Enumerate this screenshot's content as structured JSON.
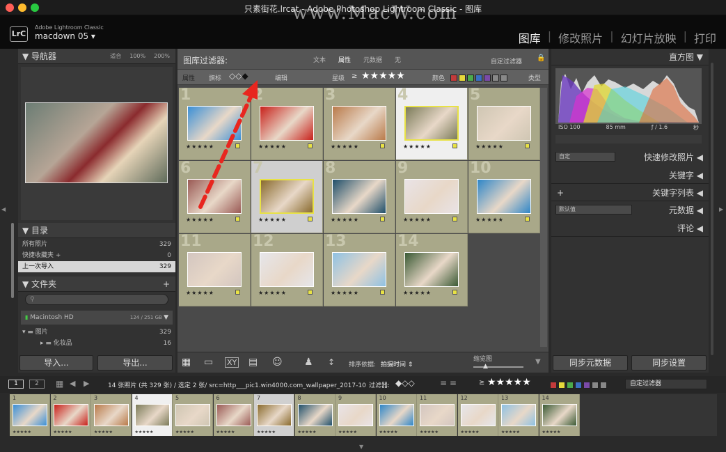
{
  "window": {
    "title": "只素街花.lrcat - Adobe Photoshop Lightroom Classic - 图库"
  },
  "watermark": "www.MacW.com",
  "identity": {
    "app": "Adobe Lightroom Classic",
    "catalog": "macdown 05"
  },
  "modules": [
    "图库",
    "修改照片",
    "幻灯片放映",
    "打印"
  ],
  "navigator": {
    "title": "导航器",
    "zoom": [
      "适合",
      "100%",
      "200%"
    ]
  },
  "catalog_panel": {
    "title": "目录",
    "items": [
      {
        "label": "所有照片",
        "count": "329"
      },
      {
        "label": "快捷收藏夹 +",
        "count": "0"
      },
      {
        "label": "上一次导入",
        "count": "329"
      }
    ]
  },
  "folders": {
    "title": "文件夹",
    "search_placeholder": "",
    "volume": "Macintosh HD",
    "volume_size": "124 / 251 GB",
    "items": [
      {
        "label": "图片",
        "count": "329"
      },
      {
        "label": "化妆品",
        "count": "16"
      }
    ]
  },
  "left_buttons": {
    "import": "导入...",
    "export": "导出..."
  },
  "filter": {
    "title": "图库过滤器:",
    "tabs": [
      "文本",
      "属性",
      "元数据",
      "无"
    ],
    "preset": "自定过滤器",
    "attr_label": "属性",
    "flag_label": "旗标",
    "edit_label": "编辑",
    "rating_label": "星级",
    "rating_op": "≥",
    "color_label": "颜色",
    "type_label": "类型"
  },
  "grid_cells": [
    {
      "num": "1",
      "color": "#3a8fd6"
    },
    {
      "num": "2",
      "color": "#c8201a"
    },
    {
      "num": "3",
      "color": "#b97a4a"
    },
    {
      "num": "4",
      "color": "#7c7c5a"
    },
    {
      "num": "5",
      "color": "#cfc6b3"
    },
    {
      "num": "6",
      "color": "#9a5a55"
    },
    {
      "num": "7",
      "color": "#8a6b2e"
    },
    {
      "num": "8",
      "color": "#1f4f6a"
    },
    {
      "num": "9",
      "color": "#e9e3e6"
    },
    {
      "num": "10",
      "color": "#2e86c8"
    },
    {
      "num": "11",
      "color": "#d3c6c0"
    },
    {
      "num": "12",
      "color": "#e6e6ea"
    },
    {
      "num": "13",
      "color": "#8ec1e3"
    },
    {
      "num": "14",
      "color": "#3a5a34"
    }
  ],
  "grid_stars": "★★★★★",
  "toolbar": {
    "sort_label": "排序依据:",
    "sort_value": "拍摄时间",
    "thumb_label": "缩览图"
  },
  "histogram": {
    "title": "直方图",
    "iso": "ISO 100",
    "focal": "85 mm",
    "aperture": "ƒ / 1.6",
    "shutter": "秒"
  },
  "quick_develop": {
    "preset": "自定",
    "title": "快速修改照片"
  },
  "keywords": {
    "title": "关键字"
  },
  "keyword_list": {
    "title": "关键字列表"
  },
  "metadata": {
    "preset": "默认值",
    "title": "元数据"
  },
  "comments": {
    "title": "评论"
  },
  "right_buttons": {
    "sync_meta": "同步元数据",
    "sync_settings": "同步设置"
  },
  "filmstrip": {
    "page1": "1",
    "page2": "2",
    "info": "14 张照片 (共 329 张) / 选定 2 张/ src=http___pic1.win4000.com_wallpaper_2017-10",
    "filter_label": "过滤器:",
    "rating_op": "≥",
    "stars": "★★★★★",
    "preset": "自定过滤器"
  },
  "label_colors": [
    "#c23b3b",
    "#e6d83b",
    "#4caa4c",
    "#3b6fc2",
    "#7a4aa8",
    "#888888",
    "#888888"
  ]
}
